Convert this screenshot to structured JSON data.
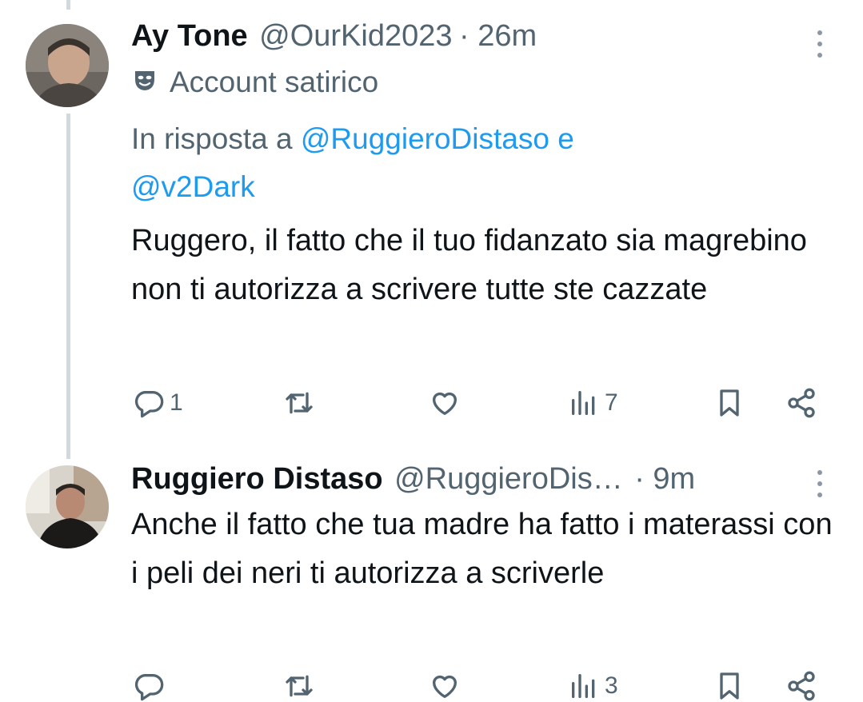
{
  "tweets": [
    {
      "name": "Ay Tone",
      "handle": "@OurKid2023",
      "time": "· 26m",
      "label": "Account satirico",
      "reply_prefix": "In risposta a",
      "reply_mention_1": "@RuggieroDistaso",
      "reply_joiner": "e",
      "reply_mention_2": "@v2Dark",
      "text": "Ruggero, il fatto che il tuo fidanzato sia magrebino non ti autorizza a scrivere tutte ste cazzate",
      "replies": "1",
      "retweets": "",
      "likes": "",
      "views": "7"
    },
    {
      "name": "Ruggiero Distaso",
      "handle": "@RuggieroDis…",
      "time": "· 9m",
      "text": "Anche il fatto che tua madre ha fatto i materassi con i peli dei neri ti autorizza a scriverle",
      "replies": "",
      "retweets": "",
      "likes": "",
      "views": "3"
    }
  ],
  "icons": {
    "label": "mask-icon",
    "reply": "reply-icon",
    "retweet": "retweet-icon",
    "like": "heart-icon",
    "views": "views-icon",
    "bookmark": "bookmark-icon",
    "share": "share-icon",
    "more": "more-icon"
  },
  "colors": {
    "text": "#0f1419",
    "secondary": "#536471",
    "link": "#1d9bf0",
    "thread_line": "#cfd9de"
  }
}
